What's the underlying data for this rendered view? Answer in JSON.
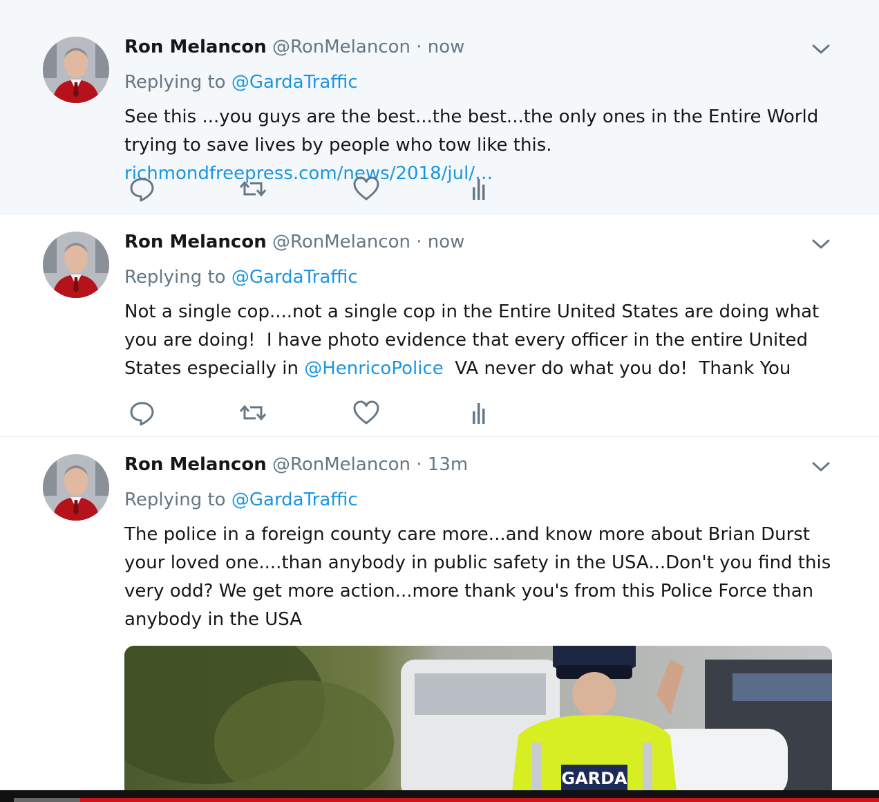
{
  "tweets": [
    {
      "name": "Ron Melancon",
      "handle": "@RonMelancon",
      "separator": "·",
      "time": "now",
      "replying_prefix": "Replying to",
      "replying_to": "@GardaTraffic",
      "body_text": "See this ...you guys are the best...the best...the only ones in the Entire World trying to save lives by people who tow like this.",
      "body_link": "richmondfreepress.com/news/2018/jul/…"
    },
    {
      "name": "Ron Melancon",
      "handle": "@RonMelancon",
      "separator": "·",
      "time": "now",
      "replying_prefix": "Replying to",
      "replying_to": "@GardaTraffic",
      "body_before": "Not a single cop....not a single cop in the Entire United States are doing what you are doing!  I have photo evidence that every officer in the entire United States especially in ",
      "body_mention": "@HenricoPolice",
      "body_after": "  VA never do what you do!  Thank You"
    },
    {
      "name": "Ron Melancon",
      "handle": "@RonMelancon",
      "separator": "·",
      "time": "13m",
      "replying_prefix": "Replying to",
      "replying_to": "@GardaTraffic",
      "body_text": "The police in a foreign county care more...and know more about Brian Durst your loved one....than anybody in public safety  in the USA...Don't you find this very odd?  We get more action...more thank you's from this Police Force than anybody in the USA",
      "media_text": "GARDA"
    }
  ],
  "icons": [
    "reply-icon",
    "retweet-icon",
    "like-icon",
    "analytics-icon",
    "chevron-down-icon"
  ],
  "colors": {
    "link": "#1b95e0",
    "secondary_text": "#657786",
    "highlight_bg": "#f5f8fa"
  }
}
